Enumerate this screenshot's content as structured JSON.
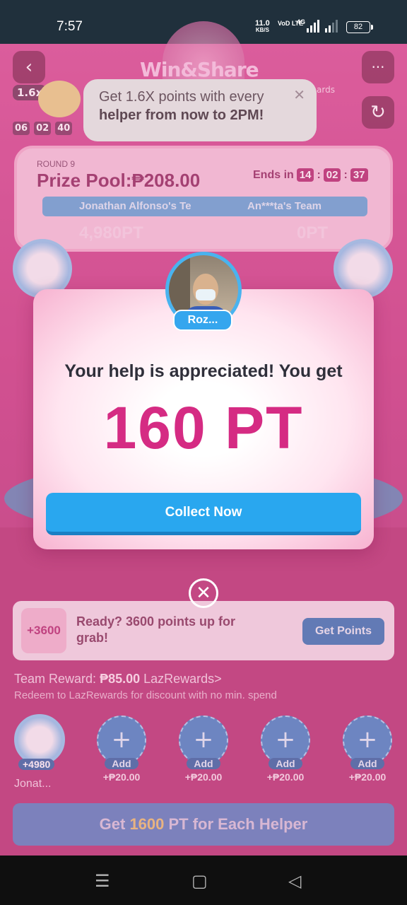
{
  "status_bar": {
    "time": "7:57",
    "net_speed": "11.0",
    "net_unit": "KB/S",
    "volte": "VoD LTE",
    "network_type": "4G",
    "battery": "82"
  },
  "header": {
    "back_icon": "back-chevron-icon",
    "more_icon": "more-dots-icon",
    "refresh_icon": "refresh-icon",
    "title_art": "Win&Share"
  },
  "multiplier": {
    "label": "1.6x",
    "countdown": [
      "06",
      "02",
      "40"
    ]
  },
  "tooltip": {
    "line1": "Get 1.6X points with every",
    "line2": "helper from now to 2PM!",
    "peek_text": "ards"
  },
  "round": {
    "label": "ROUND 9",
    "prize_pool": "Prize Pool:₱208.00",
    "ends_label": "Ends in",
    "ends_h": "14",
    "ends_m": "02",
    "ends_s": "37",
    "team_left": "Jonathan Alfonso's Te",
    "team_right": "An***ta's Team",
    "score_left": "4,980PT",
    "score_right": "0PT"
  },
  "modal": {
    "helper_name": "Roz...",
    "heading": "Your help is appreciated! You get",
    "points": "160 PT",
    "collect_label": "Collect Now",
    "close_icon": "close-x-icon"
  },
  "ready_card": {
    "bonus": "+3600",
    "text": "Ready? 3600 points up for grab!",
    "button": "Get Points"
  },
  "team_reward": {
    "label": "Team Reward:",
    "amount": "₱85.00",
    "link": "LazRewards>",
    "sub": "Redeem to LazRewards for discount with no min. spend"
  },
  "helpers": {
    "me_points": "+4980",
    "me_name": "Jonat...",
    "slots": [
      {
        "add": "Add",
        "amount": "+₱20.00"
      },
      {
        "add": "Add",
        "amount": "+₱20.00"
      },
      {
        "add": "Add",
        "amount": "+₱20.00"
      },
      {
        "add": "Add",
        "amount": "+₱20.00"
      }
    ]
  },
  "cta": {
    "prefix": "Get ",
    "highlight": "1600",
    "suffix": " PT for Each Helper"
  },
  "nav": {
    "recents_icon": "recents-icon",
    "home_icon": "home-icon",
    "back_icon": "nav-back-icon"
  },
  "colors": {
    "accent_pink": "#d52b83",
    "collect_blue": "#29a7ef",
    "helper_border": "#49b3ef"
  }
}
